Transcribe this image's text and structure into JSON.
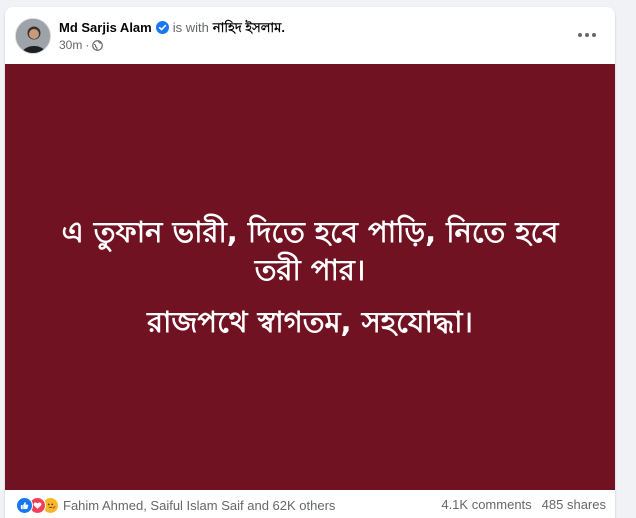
{
  "post": {
    "author": "Md Sarjis Alam",
    "with_text": "is with",
    "tagged": "নাহিদ ইসলাম.",
    "time": "30m",
    "separator": "·",
    "image_text": {
      "line1": "এ তুফান ভারী, দিতে হবে পাড়ি, নিতে হবে তরী পার।",
      "line2": "রাজপথে স্বাগতম, সহযোদ্ধা।",
      "background": "#701221"
    }
  },
  "footer": {
    "reactors": "Fahim Ahmed, Saiful Islam Saif and 62K others",
    "comments": "4.1K comments",
    "shares": "485 shares"
  },
  "icons": {
    "verified": "verified-badge-icon",
    "privacy": "globe-icon",
    "more": "more-options-icon",
    "reactions": [
      "like-reaction-icon",
      "love-reaction-icon",
      "care-reaction-icon"
    ]
  },
  "colors": {
    "accent": "#1877f2",
    "image_bg": "#701221",
    "secondary_text": "#65676b"
  }
}
